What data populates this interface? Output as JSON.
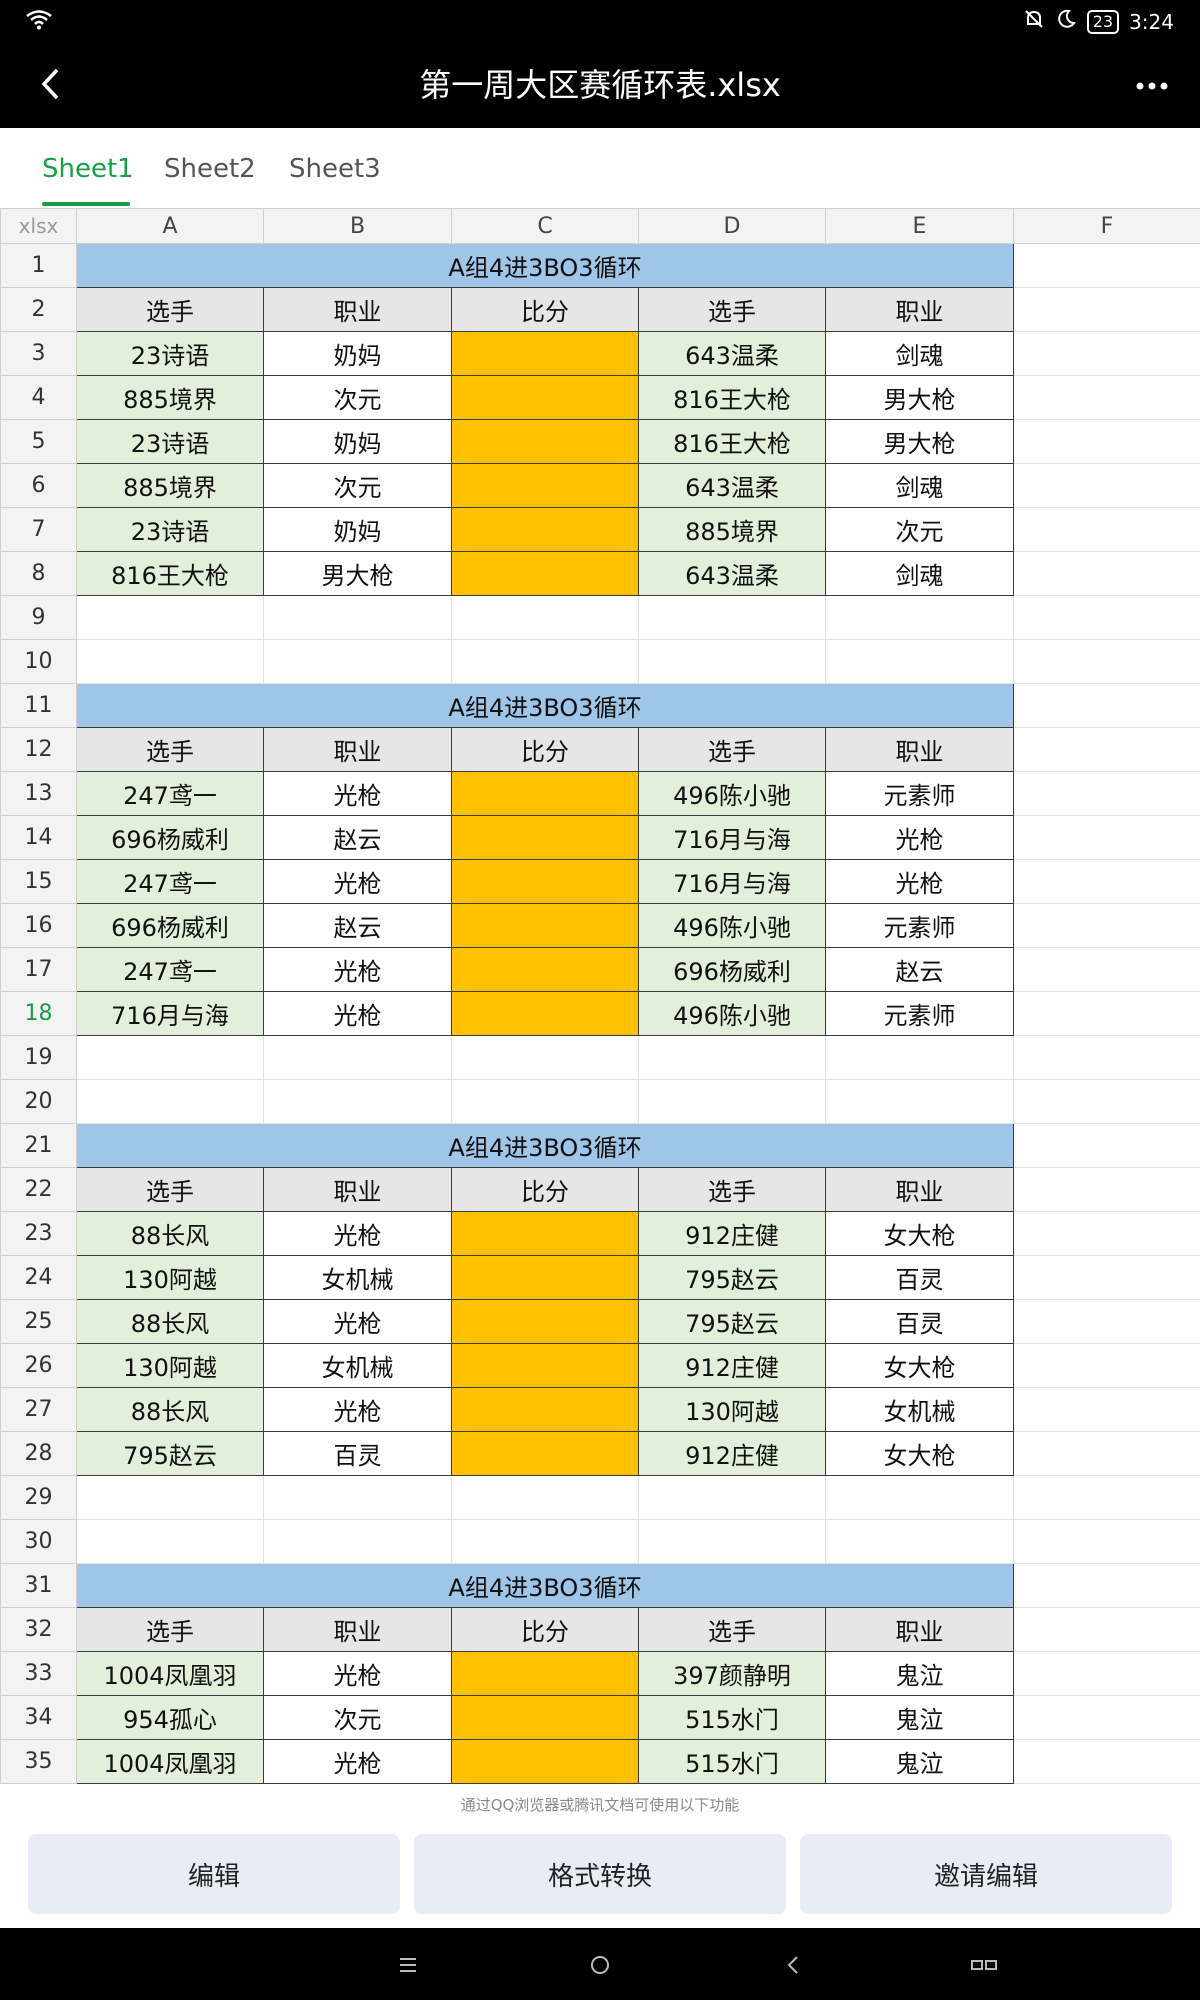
{
  "status_bar": {
    "time": "3:24",
    "battery": "23"
  },
  "title_bar": {
    "title": "第一周大区赛循环表.xlsx"
  },
  "sheet_tabs": [
    "Sheet1",
    "Sheet2",
    "Sheet3"
  ],
  "grid": {
    "corner_label": "xlsx",
    "columns": [
      "A",
      "B",
      "C",
      "D",
      "E",
      "F"
    ],
    "block_title": "A组4进3BO3循环",
    "headers": [
      "选手",
      "职业",
      "比分",
      "选手",
      "职业"
    ],
    "blocks": [
      {
        "matches": [
          [
            "23诗语",
            "奶妈",
            "643温柔",
            "剑魂"
          ],
          [
            "885境界",
            "次元",
            "816王大枪",
            "男大枪"
          ],
          [
            "23诗语",
            "奶妈",
            "816王大枪",
            "男大枪"
          ],
          [
            "885境界",
            "次元",
            "643温柔",
            "剑魂"
          ],
          [
            "23诗语",
            "奶妈",
            "885境界",
            "次元"
          ],
          [
            "816王大枪",
            "男大枪",
            "643温柔",
            "剑魂"
          ]
        ]
      },
      {
        "matches": [
          [
            "247鸢一",
            "光枪",
            "496陈小驰",
            "元素师"
          ],
          [
            "696杨威利",
            "赵云",
            "716月与海",
            "光枪"
          ],
          [
            "247鸢一",
            "光枪",
            "716月与海",
            "光枪"
          ],
          [
            "696杨威利",
            "赵云",
            "496陈小驰",
            "元素师"
          ],
          [
            "247鸢一",
            "光枪",
            "696杨威利",
            "赵云"
          ],
          [
            "716月与海",
            "光枪",
            "496陈小驰",
            "元素师"
          ]
        ]
      },
      {
        "matches": [
          [
            "88长风",
            "光枪",
            "912庄健",
            "女大枪"
          ],
          [
            "130阿越",
            "女机械",
            "795赵云",
            "百灵"
          ],
          [
            "88长风",
            "光枪",
            "795赵云",
            "百灵"
          ],
          [
            "130阿越",
            "女机械",
            "912庄健",
            "女大枪"
          ],
          [
            "88长风",
            "光枪",
            "130阿越",
            "女机械"
          ],
          [
            "795赵云",
            "百灵",
            "912庄健",
            "女大枪"
          ]
        ]
      },
      {
        "matches": [
          [
            "1004凤凰羽",
            "光枪",
            "397颜静明",
            "鬼泣"
          ],
          [
            "954孤心",
            "次元",
            "515水门",
            "鬼泣"
          ],
          [
            "1004凤凰羽",
            "光枪",
            "515水门",
            "鬼泣"
          ]
        ]
      }
    ],
    "active_row": 18
  },
  "notice": "通过QQ浏览器或腾讯文档可使用以下功能",
  "actions": {
    "edit": "编辑",
    "convert": "格式转换",
    "invite": "邀请编辑"
  },
  "colors": {
    "title_fill": "#9fc5e8",
    "player_fill": "#e2efda",
    "score_fill": "#ffc000",
    "accent": "#1a9e45"
  }
}
